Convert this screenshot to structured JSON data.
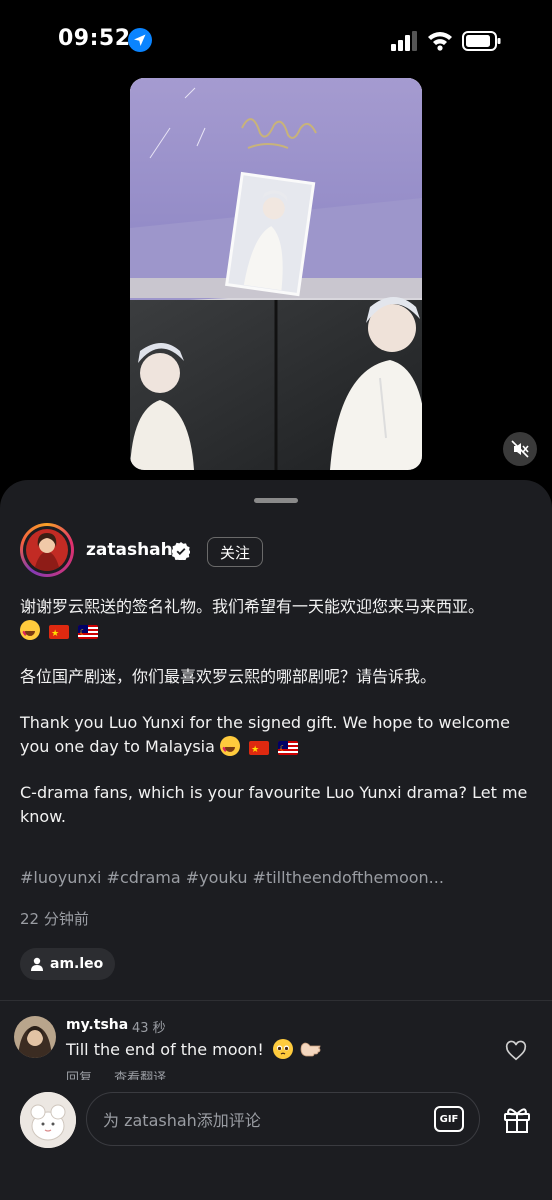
{
  "status_bar": {
    "time": "09:52"
  },
  "post": {
    "username": "zatashah",
    "follow_label": "关注",
    "caption": {
      "line1_zh": "谢谢罗云熙送的签名礼物。我们希望有一天能欢迎您来马来西亚。",
      "line2_zh": "各位国产剧迷，你们最喜欢罗云熙的哪部剧呢？请告诉我。",
      "line3_en": "Thank you Luo Yunxi for the signed gift. We hope to welcome you one day to Malaysia",
      "line4_en": "C-drama fans, which is your favourite Luo Yunxi drama? Let me know."
    },
    "hashtags": "#luoyunxi  #cdrama #youku #tilltheendofthemoon...",
    "time_ago": "22 分钟前",
    "tagged_user": "am.leo"
  },
  "comment": {
    "username": "my.tsha",
    "time": "43 秒",
    "text": "Till the end of the moon!",
    "reply_label": "回复",
    "translate_label": "查看翻译"
  },
  "input": {
    "placeholder": "为 zatashah添加评论",
    "gif_label": "GIF"
  },
  "icons": {
    "location": "location-arrow-icon",
    "signal": "cellular-signal-icon",
    "wifi": "wifi-icon",
    "battery": "battery-icon",
    "mute": "speaker-muted-icon",
    "verified": "verified-badge-icon",
    "person": "person-icon",
    "heart": "heart-icon",
    "gift": "gift-icon"
  },
  "colors": {
    "background": "#000000",
    "sheet": "#1c1d21",
    "secondary_text": "#9a9da3",
    "location_blue": "#0a84ff"
  }
}
